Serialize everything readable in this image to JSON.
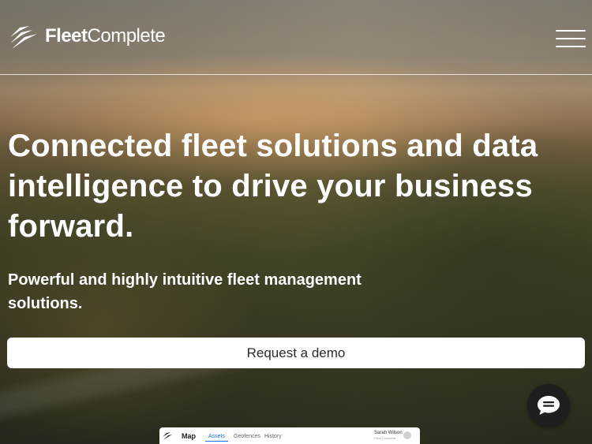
{
  "header": {
    "logo": {
      "word1": "Fleet",
      "word2": "Complete",
      "icon": "fleet-complete-logo-icon"
    },
    "menu": {
      "icon": "hamburger-menu-icon"
    }
  },
  "hero": {
    "headline": "Connected fleet solutions and data intelligence to drive your business forward.",
    "subheadline": "Powerful and highly intuitive fleet management solutions.",
    "cta_label": "Request a demo"
  },
  "chat": {
    "icon": "chat-bubble-icon"
  },
  "app_preview": {
    "title": "Map",
    "tabs": [
      {
        "label": "Assets",
        "active": true
      },
      {
        "label": "Geofences",
        "active": false
      },
      {
        "label": "History",
        "active": false
      }
    ],
    "user_name": "Sarah Wilson",
    "user_sub": "Fleet Complete",
    "accent_color": "#1a73e8"
  },
  "colors": {
    "cta_background": "#ffffff",
    "cta_text": "#2b2b2b",
    "chat_background": "#1e1e1e"
  }
}
